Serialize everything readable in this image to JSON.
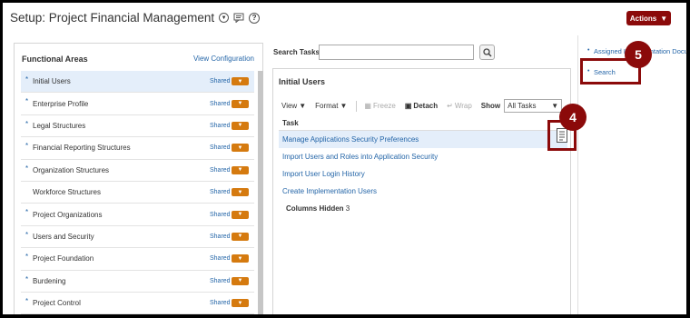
{
  "header": {
    "title": "Setup: Project Financial Management",
    "actions_label": "Actions"
  },
  "functional_areas": {
    "title": "Functional Areas",
    "view_config": "View Configuration",
    "shared_label": "Shared",
    "items": [
      {
        "label": "Initial Users",
        "required": "*"
      },
      {
        "label": "Enterprise Profile",
        "required": "*"
      },
      {
        "label": "Legal Structures",
        "required": "*"
      },
      {
        "label": "Financial Reporting Structures",
        "required": "*"
      },
      {
        "label": "Organization Structures",
        "required": "*"
      },
      {
        "label": "Workforce Structures",
        "required": ""
      },
      {
        "label": "Project Organizations",
        "required": "*"
      },
      {
        "label": "Users and Security",
        "required": "*"
      },
      {
        "label": "Project Foundation",
        "required": "*"
      },
      {
        "label": "Burdening",
        "required": "*"
      },
      {
        "label": "Project Control",
        "required": "*"
      }
    ]
  },
  "search": {
    "label": "Search Tasks",
    "value": "",
    "placeholder": ""
  },
  "tasks_panel": {
    "title": "Initial Users",
    "toolbar": {
      "view": "View",
      "format": "Format",
      "freeze": "Freeze",
      "detach": "Detach",
      "wrap": "Wrap",
      "show": "Show",
      "show_value": "All Tasks"
    },
    "column_header": "Task",
    "rows": [
      "Manage Applications Security Preferences",
      "Import Users and Roles into Application Security",
      "Import User Login History",
      "Create Implementation Users"
    ],
    "columns_hidden_label": "Columns Hidden",
    "columns_hidden_count": "3"
  },
  "right_links": [
    "Assigned Implementation Documentation",
    "Search"
  ],
  "callouts": [
    "4",
    "5"
  ],
  "colors": {
    "accent": "#8b0a0a",
    "link": "#2566a8",
    "orange": "#d57a0f",
    "selected": "#e4eefa"
  }
}
